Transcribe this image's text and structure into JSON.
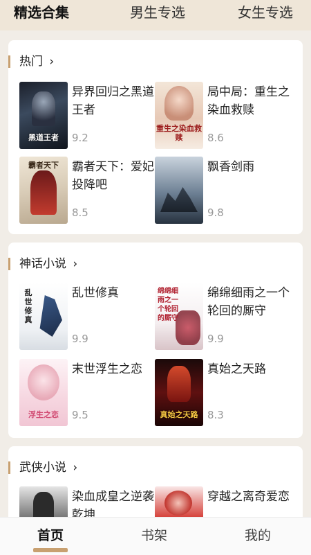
{
  "top_tabs": [
    {
      "label": "精选合集",
      "active": true
    },
    {
      "label": "男生专选",
      "active": false
    },
    {
      "label": "女生专选",
      "active": false
    }
  ],
  "sections": [
    {
      "title": "热门",
      "books": [
        {
          "title": "异界回归之黑道王者",
          "score": "9.2"
        },
        {
          "title": "局中局：重生之染血救赎",
          "score": "8.6"
        },
        {
          "title": "霸者天下：爱妃投降吧",
          "score": "8.5"
        },
        {
          "title": "飘香剑雨",
          "score": "9.8"
        }
      ]
    },
    {
      "title": "神话小说",
      "books": [
        {
          "title": "乱世修真",
          "score": "9.9"
        },
        {
          "title": "绵绵细雨之一个轮回的厮守",
          "score": "9.9"
        },
        {
          "title": "末世浮生之恋",
          "score": "9.5"
        },
        {
          "title": "真始之天路",
          "score": "8.3"
        }
      ]
    },
    {
      "title": "武侠小说",
      "books": [
        {
          "title": "染血成皇之逆袭乾坤",
          "score": ""
        },
        {
          "title": "穿越之离奇爱恋",
          "score": ""
        }
      ]
    }
  ],
  "covers": [
    "黑道王者",
    "重生之染血救赎",
    "霸者天下",
    "",
    "乱世修真",
    "绵绵细雨之一个轮回的厮守",
    "浮生之恋",
    "真始之天路"
  ],
  "bottom_nav": [
    {
      "label": "首页",
      "active": true
    },
    {
      "label": "书架",
      "active": false
    },
    {
      "label": "我的",
      "active": false
    }
  ],
  "chevron": "›",
  "colors": {
    "accent": "#c8a070",
    "header_bg": "#efe6d8",
    "score": "#999999"
  }
}
